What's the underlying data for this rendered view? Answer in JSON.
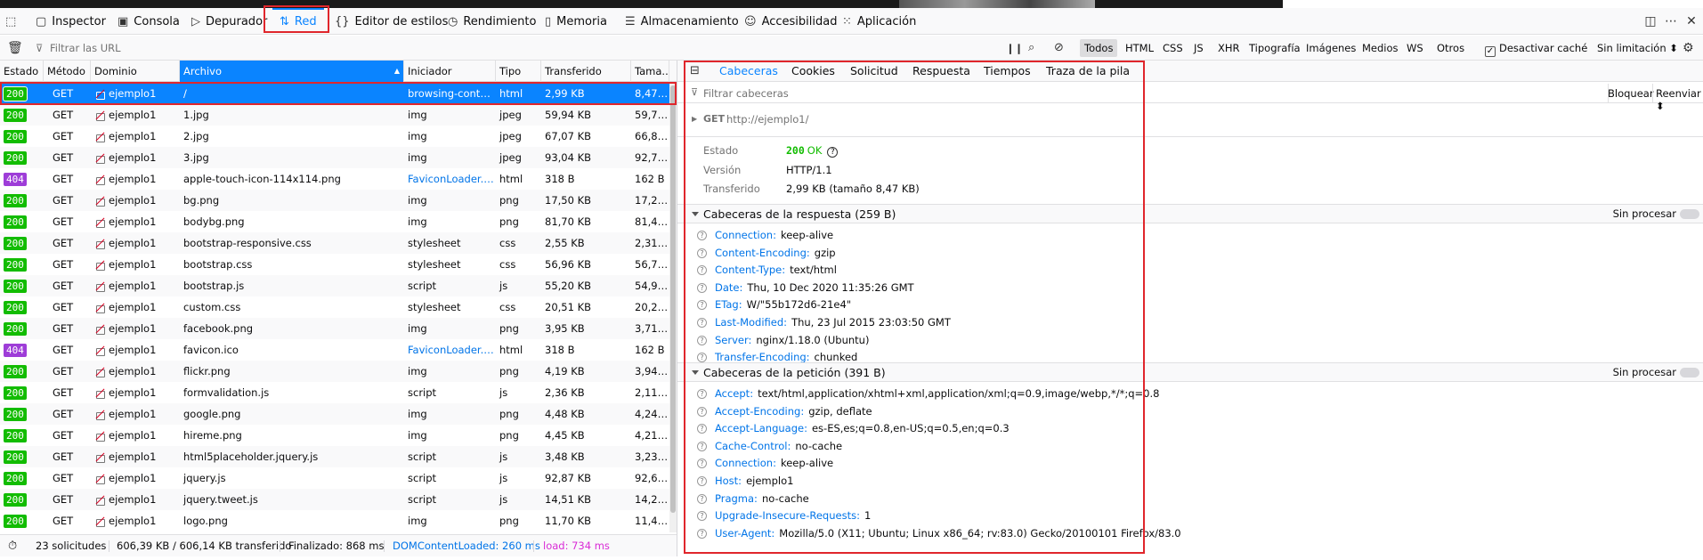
{
  "devtools_tabs": [
    {
      "label": "Inspector",
      "icon": "inspector-icon"
    },
    {
      "label": "Consola",
      "icon": "console-icon"
    },
    {
      "label": "Depurador",
      "icon": "debugger-icon"
    },
    {
      "label": "Red",
      "icon": "network-icon",
      "selected": true
    },
    {
      "label": "Editor de estilos",
      "icon": "style-editor-icon"
    },
    {
      "label": "Rendimiento",
      "icon": "performance-icon"
    },
    {
      "label": "Memoria",
      "icon": "memory-icon"
    },
    {
      "label": "Almacenamiento",
      "icon": "storage-icon"
    },
    {
      "label": "Accesibilidad",
      "icon": "accessibility-icon"
    },
    {
      "label": "Aplicación",
      "icon": "application-icon"
    }
  ],
  "filter": {
    "placeholder": "Filtrar las URL",
    "types": [
      "Todos",
      "HTML",
      "CSS",
      "JS",
      "XHR",
      "Tipografía",
      "Imágenes",
      "Medios",
      "WS",
      "Otros"
    ],
    "selected_type": "Todos",
    "disable_cache_label": "Desactivar caché",
    "throttle": "Sin limitación ⬍"
  },
  "columns": {
    "estado": "Estado",
    "metodo": "Método",
    "dominio": "Dominio",
    "archivo": "Archivo",
    "iniciador": "Iniciador",
    "tipo": "Tipo",
    "transferido": "Transferido",
    "tamano": "Tama..."
  },
  "requests": [
    {
      "status": "200",
      "method": "GET",
      "domain": "ejemplo1",
      "file": "/",
      "initiator": "browsing-conte...",
      "type": "html",
      "transferred": "2,99 KB",
      "size": "8,47 KB"
    },
    {
      "status": "200",
      "method": "GET",
      "domain": "ejemplo1",
      "file": "1.jpg",
      "initiator": "img",
      "type": "jpeg",
      "transferred": "59,94 KB",
      "size": "59,70 ..."
    },
    {
      "status": "200",
      "method": "GET",
      "domain": "ejemplo1",
      "file": "2.jpg",
      "initiator": "img",
      "type": "jpeg",
      "transferred": "67,07 KB",
      "size": "66,82 ..."
    },
    {
      "status": "200",
      "method": "GET",
      "domain": "ejemplo1",
      "file": "3.jpg",
      "initiator": "img",
      "type": "jpeg",
      "transferred": "93,04 KB",
      "size": "92,79 ..."
    },
    {
      "status": "404",
      "method": "GET",
      "domain": "ejemplo1",
      "file": "apple-touch-icon-114x114.png",
      "initiator": "FaviconLoader.j...",
      "type": "html",
      "transferred": "318 B",
      "size": "162 B"
    },
    {
      "status": "200",
      "method": "GET",
      "domain": "ejemplo1",
      "file": "bg.png",
      "initiator": "img",
      "type": "png",
      "transferred": "17,50 KB",
      "size": "17,26 ..."
    },
    {
      "status": "200",
      "method": "GET",
      "domain": "ejemplo1",
      "file": "bodybg.png",
      "initiator": "img",
      "type": "png",
      "transferred": "81,70 KB",
      "size": "81,45 ..."
    },
    {
      "status": "200",
      "method": "GET",
      "domain": "ejemplo1",
      "file": "bootstrap-responsive.css",
      "initiator": "stylesheet",
      "type": "css",
      "transferred": "2,55 KB",
      "size": "2,31 KB"
    },
    {
      "status": "200",
      "method": "GET",
      "domain": "ejemplo1",
      "file": "bootstrap.css",
      "initiator": "stylesheet",
      "type": "css",
      "transferred": "56,96 KB",
      "size": "56,72 ..."
    },
    {
      "status": "200",
      "method": "GET",
      "domain": "ejemplo1",
      "file": "bootstrap.js",
      "initiator": "script",
      "type": "js",
      "transferred": "55,20 KB",
      "size": "54,95 ..."
    },
    {
      "status": "200",
      "method": "GET",
      "domain": "ejemplo1",
      "file": "custom.css",
      "initiator": "stylesheet",
      "type": "css",
      "transferred": "20,51 KB",
      "size": "20,27 ..."
    },
    {
      "status": "200",
      "method": "GET",
      "domain": "ejemplo1",
      "file": "facebook.png",
      "initiator": "img",
      "type": "png",
      "transferred": "3,95 KB",
      "size": "3,71 KB"
    },
    {
      "status": "404",
      "method": "GET",
      "domain": "ejemplo1",
      "file": "favicon.ico",
      "initiator": "FaviconLoader.j...",
      "type": "html",
      "transferred": "318 B",
      "size": "162 B"
    },
    {
      "status": "200",
      "method": "GET",
      "domain": "ejemplo1",
      "file": "flickr.png",
      "initiator": "img",
      "type": "png",
      "transferred": "4,19 KB",
      "size": "3,94 KB"
    },
    {
      "status": "200",
      "method": "GET",
      "domain": "ejemplo1",
      "file": "formvalidation.js",
      "initiator": "script",
      "type": "js",
      "transferred": "2,36 KB",
      "size": "2,11 KB"
    },
    {
      "status": "200",
      "method": "GET",
      "domain": "ejemplo1",
      "file": "google.png",
      "initiator": "img",
      "type": "png",
      "transferred": "4,48 KB",
      "size": "4,24 KB"
    },
    {
      "status": "200",
      "method": "GET",
      "domain": "ejemplo1",
      "file": "hireme.png",
      "initiator": "img",
      "type": "png",
      "transferred": "4,45 KB",
      "size": "4,21 KB"
    },
    {
      "status": "200",
      "method": "GET",
      "domain": "ejemplo1",
      "file": "html5placeholder.jquery.js",
      "initiator": "script",
      "type": "js",
      "transferred": "3,48 KB",
      "size": "3,23 KB"
    },
    {
      "status": "200",
      "method": "GET",
      "domain": "ejemplo1",
      "file": "jquery.js",
      "initiator": "script",
      "type": "js",
      "transferred": "92,87 KB",
      "size": "92,62 ..."
    },
    {
      "status": "200",
      "method": "GET",
      "domain": "ejemplo1",
      "file": "jquery.tweet.js",
      "initiator": "script",
      "type": "js",
      "transferred": "14,51 KB",
      "size": "14,25 ..."
    },
    {
      "status": "200",
      "method": "GET",
      "domain": "ejemplo1",
      "file": "logo.png",
      "initiator": "img",
      "type": "png",
      "transferred": "11,70 KB",
      "size": "11,46 ..."
    }
  ],
  "status": {
    "requests": "23 solicitudes",
    "transferred": "606,39 KB / 606,14 KB transferido",
    "finished": "Finalizado: 868 ms",
    "dcl": "DOMContentLoaded: 260 ms",
    "load": "load: 734 ms"
  },
  "detail": {
    "tabs": [
      "Cabeceras",
      "Cookies",
      "Solicitud",
      "Respuesta",
      "Tiempos",
      "Traza de la pila"
    ],
    "selected_tab": "Cabeceras",
    "filter_placeholder": "Filtrar cabeceras",
    "block_label": "Bloquear",
    "resend_label": "Reenviar ⬍",
    "request_line_method": "GET",
    "request_line_url": "http://ejemplo1/",
    "estado_label": "Estado",
    "estado_code": "200",
    "estado_text": "OK",
    "version_label": "Versión",
    "version_value": "HTTP/1.1",
    "transferido_label": "Transferido",
    "transferido_value": "2,99 KB (tamaño 8,47 KB)",
    "response_section": "Cabeceras de la respuesta (259 B)",
    "request_section": "Cabeceras de la petición (391 B)",
    "raw_label": "Sin procesar",
    "response_headers": [
      {
        "name": "Connection:",
        "value": "keep-alive"
      },
      {
        "name": "Content-Encoding:",
        "value": "gzip"
      },
      {
        "name": "Content-Type:",
        "value": "text/html"
      },
      {
        "name": "Date:",
        "value": "Thu, 10 Dec 2020 11:35:26 GMT"
      },
      {
        "name": "ETag:",
        "value": "W/\"55b172d6-21e4\""
      },
      {
        "name": "Last-Modified:",
        "value": "Thu, 23 Jul 2015 23:03:50 GMT"
      },
      {
        "name": "Server:",
        "value": "nginx/1.18.0 (Ubuntu)"
      },
      {
        "name": "Transfer-Encoding:",
        "value": "chunked"
      }
    ],
    "request_headers": [
      {
        "name": "Accept:",
        "value": "text/html,application/xhtml+xml,application/xml;q=0.9,image/webp,*/*;q=0.8"
      },
      {
        "name": "Accept-Encoding:",
        "value": "gzip, deflate"
      },
      {
        "name": "Accept-Language:",
        "value": "es-ES,es;q=0.8,en-US;q=0.5,en;q=0.3"
      },
      {
        "name": "Cache-Control:",
        "value": "no-cache"
      },
      {
        "name": "Connection:",
        "value": "keep-alive"
      },
      {
        "name": "Host:",
        "value": "ejemplo1"
      },
      {
        "name": "Pragma:",
        "value": "no-cache"
      },
      {
        "name": "Upgrade-Insecure-Requests:",
        "value": "1"
      },
      {
        "name": "User-Agent:",
        "value": "Mozilla/5.0 (X11; Ubuntu; Linux x86_64; rv:83.0) Gecko/20100101 Firefox/83.0"
      }
    ]
  },
  "colors": {
    "accent": "#0a84ff",
    "ok": "#12bc00",
    "not_found": "#9e3dd8",
    "highlight_box": "#e0262c",
    "dcl": "#0074e8",
    "load": "#d92cd6"
  }
}
